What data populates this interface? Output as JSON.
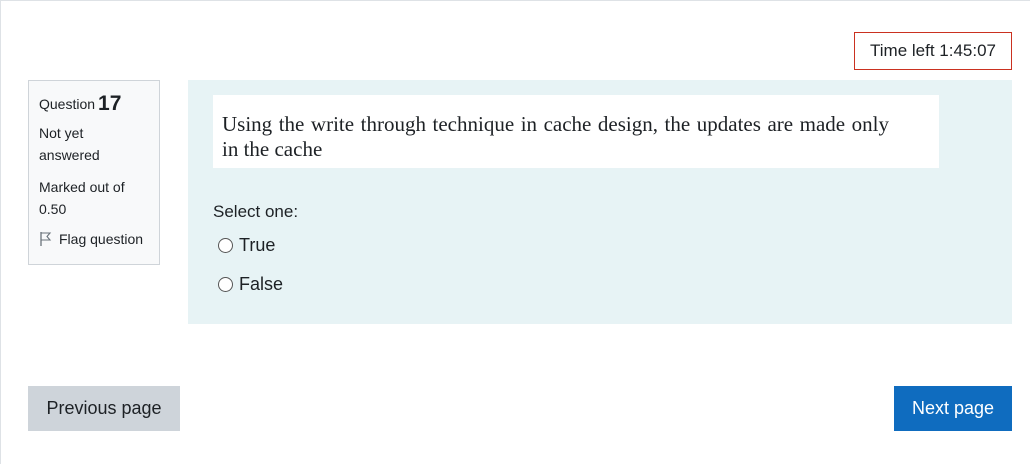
{
  "timer": {
    "label": "Time left 1:45:07"
  },
  "question_info": {
    "question_label": "Question",
    "question_number": "17",
    "state": "Not yet answered",
    "grade": "Marked out of 0.50",
    "flag_label": "Flag question",
    "flag_icon": "flag-outline-icon"
  },
  "question": {
    "text": "Using the write through technique in cache design, the updates are made only in the cache",
    "prompt": "Select one:",
    "answers": [
      {
        "label": "True",
        "checked": false
      },
      {
        "label": "False",
        "checked": false
      }
    ]
  },
  "navigation": {
    "previous_label": "Previous page",
    "next_label": "Next page"
  },
  "colors": {
    "content_bg": "#e7f3f5",
    "timer_border": "#ca3120",
    "next_button": "#0f6cbf",
    "prev_button": "#ced4da"
  }
}
